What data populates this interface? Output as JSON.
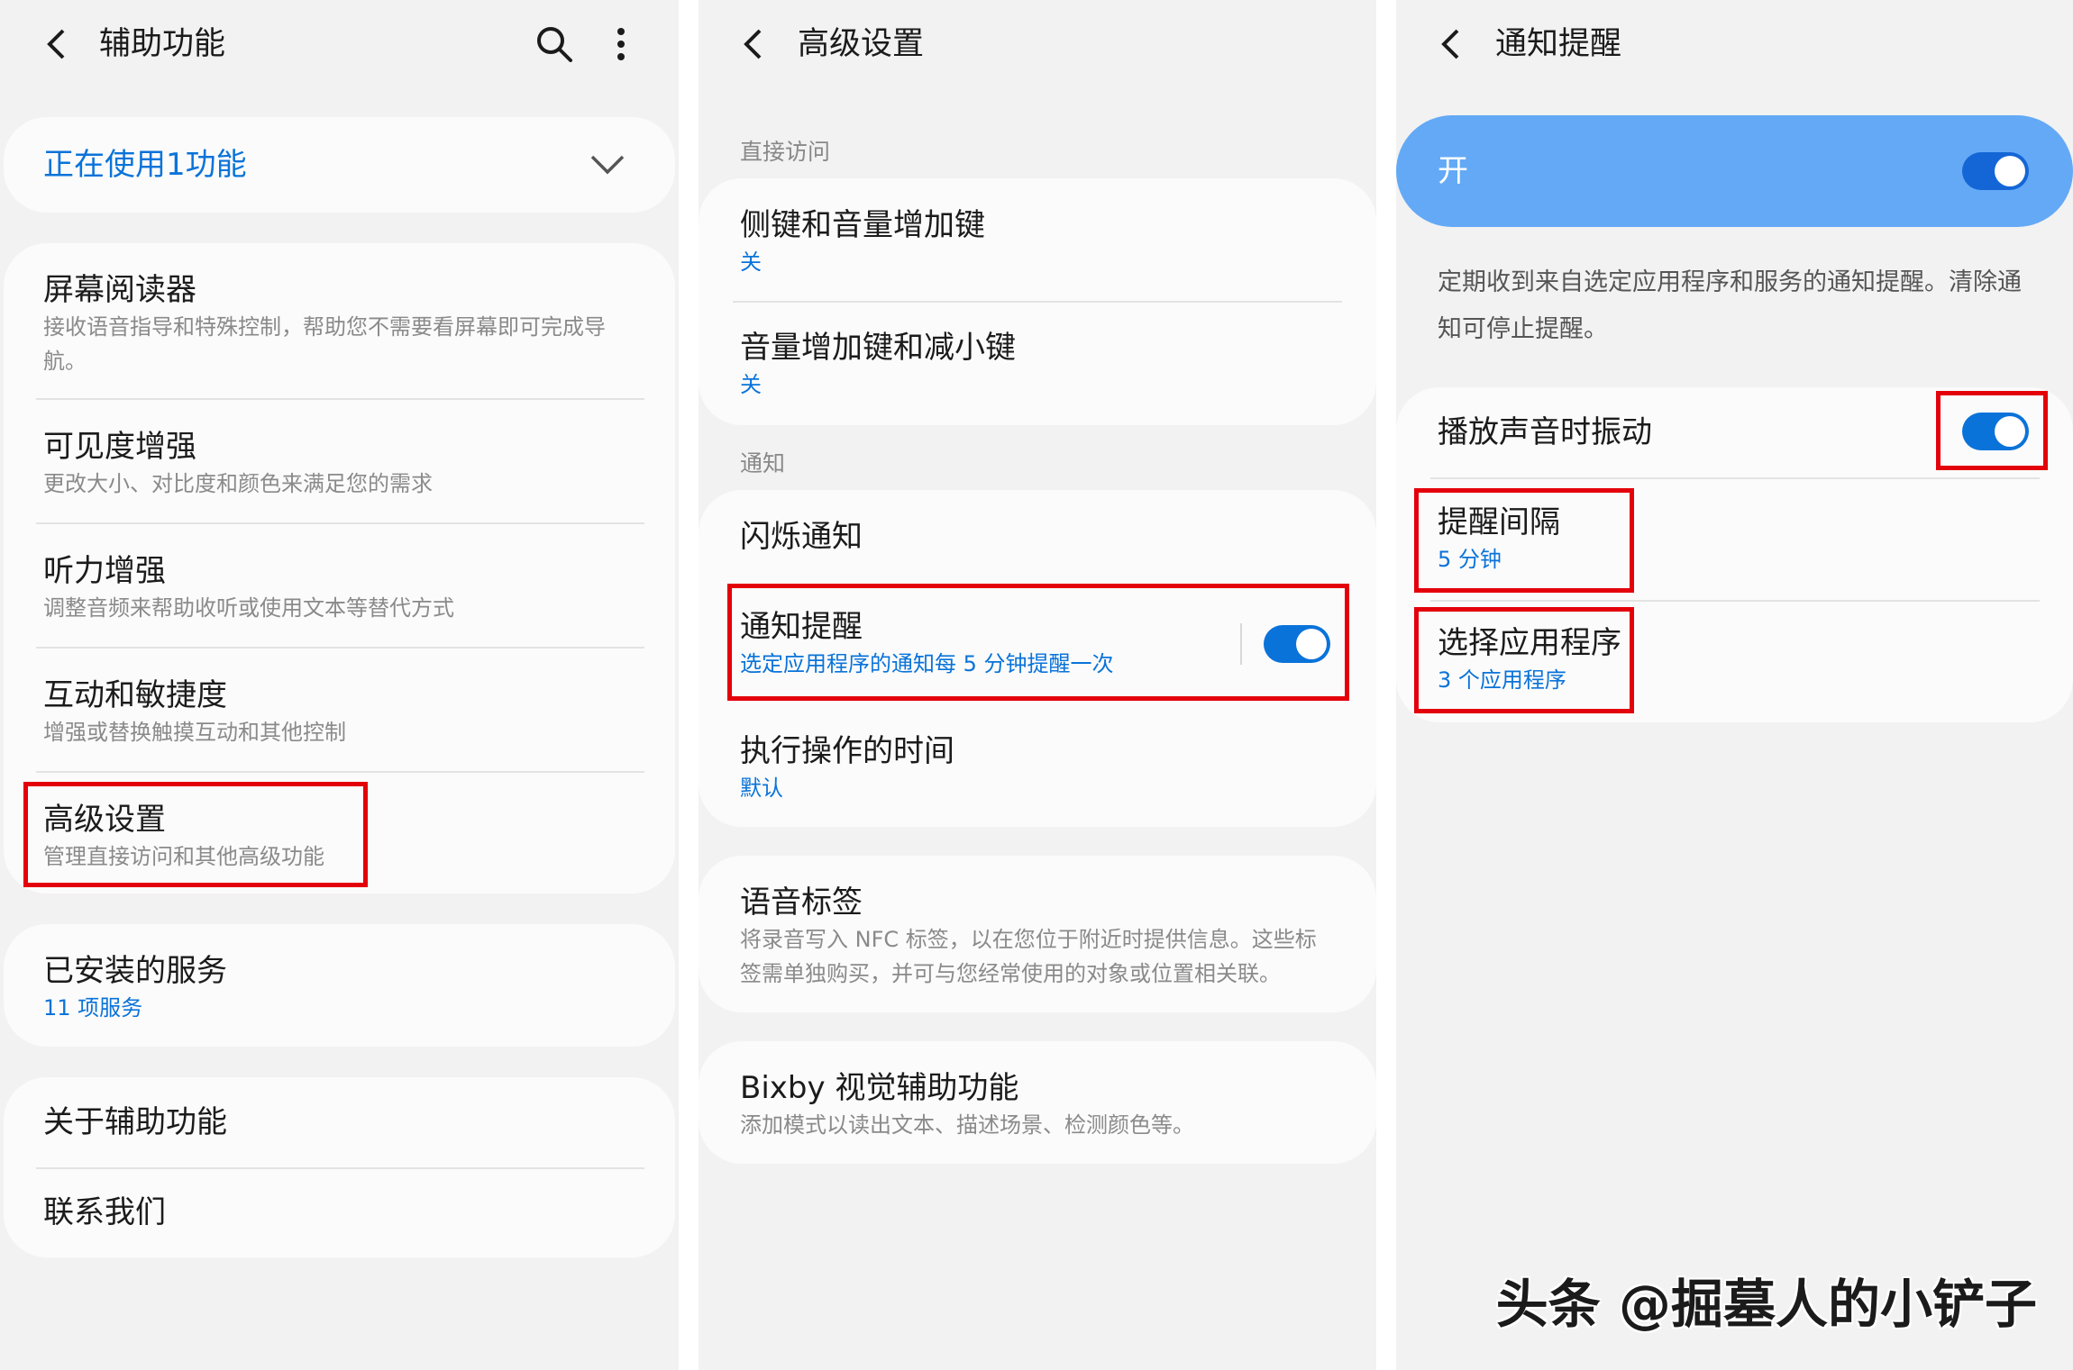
{
  "panel1": {
    "title": "辅助功能",
    "active_banner": "正在使用1功能",
    "items": [
      {
        "title": "屏幕阅读器",
        "sub": "接收语音指导和特殊控制，帮助您不需要看屏幕即可完成导航。"
      },
      {
        "title": "可见度增强",
        "sub": "更改大小、对比度和颜色来满足您的需求"
      },
      {
        "title": "听力增强",
        "sub": "调整音频来帮助收听或使用文本等替代方式"
      },
      {
        "title": "互动和敏捷度",
        "sub": "增强或替换触摸互动和其他控制"
      },
      {
        "title": "高级设置",
        "sub": "管理直接访问和其他高级功能"
      }
    ],
    "installed": {
      "title": "已安装的服务",
      "sub": "11 项服务"
    },
    "about": "关于辅助功能",
    "contact": "联系我们"
  },
  "panel2": {
    "title": "高级设置",
    "section_direct": "直接访问",
    "side_key": {
      "title": "侧键和音量增加键",
      "sub": "关"
    },
    "vol_keys": {
      "title": "音量增加键和减小键",
      "sub": "关"
    },
    "section_notify": "通知",
    "flash": "闪烁通知",
    "reminder": {
      "title": "通知提醒",
      "sub": "选定应用程序的通知每 5 分钟提醒一次",
      "on": true
    },
    "action_time": {
      "title": "执行操作的时间",
      "sub": "默认"
    },
    "voice_label": {
      "title": "语音标签",
      "sub": "将录音写入 NFC 标签，以在您位于附近时提供信息。这些标签需单独购买，并可与您经常使用的对象或位置相关联。"
    },
    "bixby": {
      "title": "Bixby 视觉辅助功能",
      "sub": "添加模式以读出文本、描述场景、检测颜色等。"
    }
  },
  "panel3": {
    "title": "通知提醒",
    "master": {
      "label": "开",
      "on": true
    },
    "description": "定期收到来自选定应用程序和服务的通知提醒。清除通知可停止提醒。",
    "vibrate": {
      "title": "播放声音时振动",
      "on": true
    },
    "interval": {
      "title": "提醒间隔",
      "sub": "5 分钟"
    },
    "apps": {
      "title": "选择应用程序",
      "sub": "3 个应用程序"
    }
  },
  "watermark": "头条 @掘墓人的小铲子",
  "colors": {
    "accent": "#0a73d9",
    "master_card": "#64a9f5",
    "highlight": "#e3000b",
    "background": "#f2f2f2",
    "card": "#fbfbfb"
  }
}
